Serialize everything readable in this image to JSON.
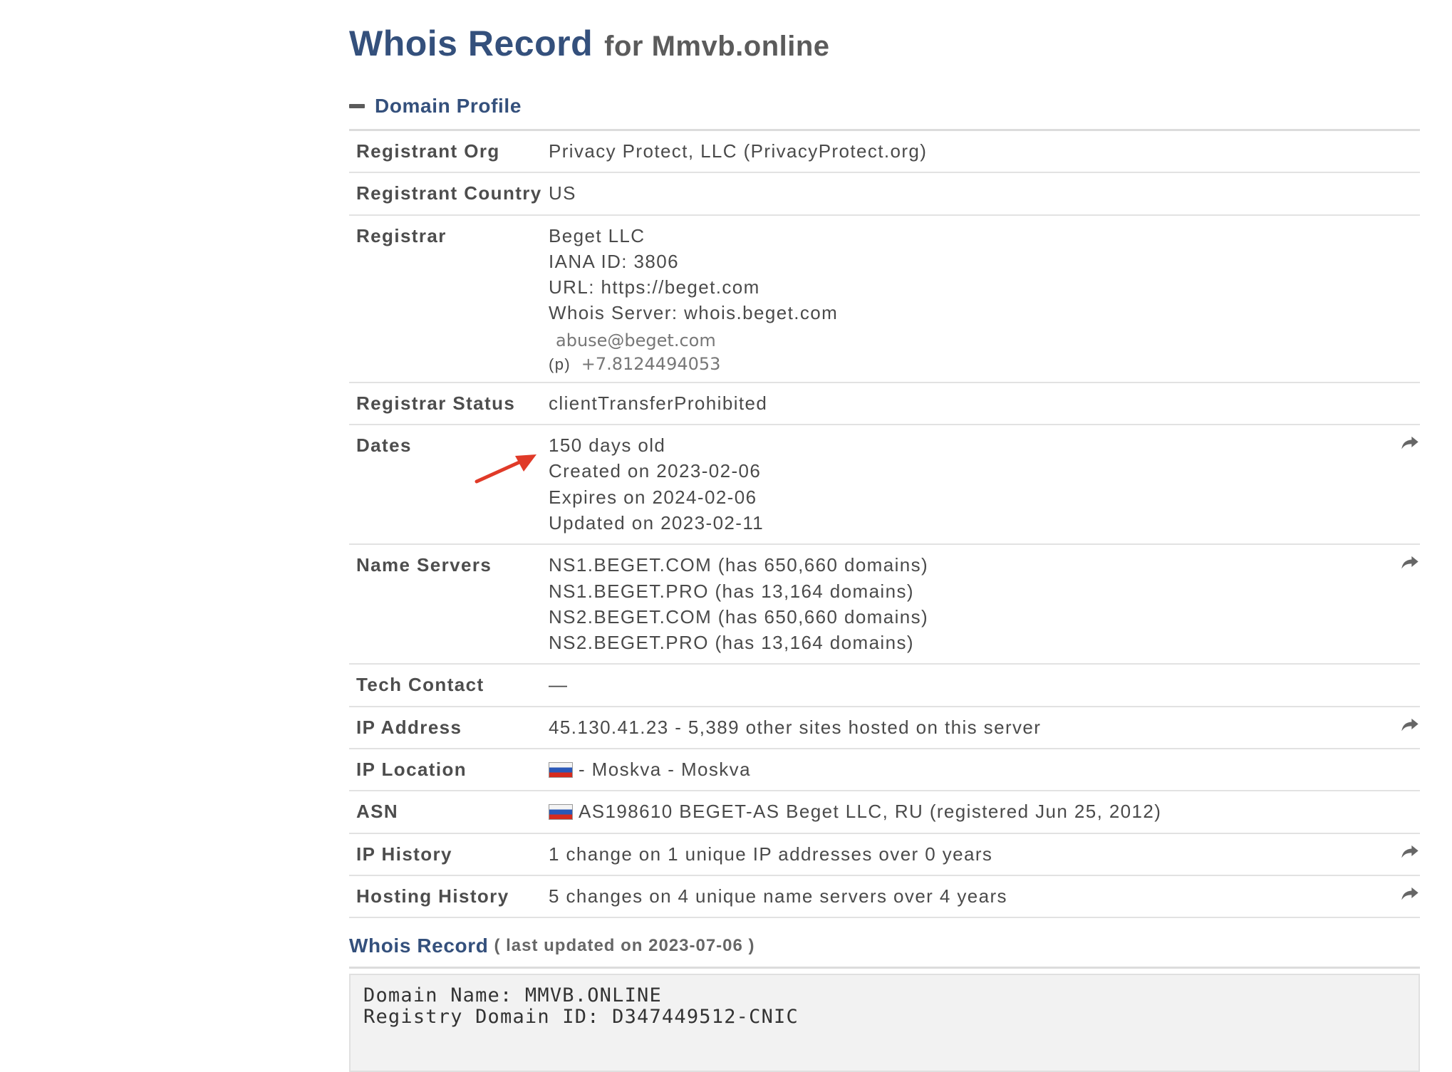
{
  "header": {
    "title": "Whois Record",
    "subtitle": "for Mmvb.online"
  },
  "domain_profile": {
    "section_label": "Domain Profile",
    "rows": {
      "registrant_org": {
        "label": "Registrant Org",
        "value": "Privacy Protect, LLC (PrivacyProtect.org)"
      },
      "registrant_country": {
        "label": "Registrant Country",
        "value": "US"
      },
      "registrar": {
        "label": "Registrar",
        "lines": [
          "Beget LLC",
          "IANA ID: 3806",
          "URL: https://beget.com",
          "Whois Server: whois.beget.com"
        ],
        "email": "abuse@beget.com",
        "phone_prefix": "(p)",
        "phone": "+7.8124494053"
      },
      "registrar_status": {
        "label": "Registrar Status",
        "value": "clientTransferProhibited"
      },
      "dates": {
        "label": "Dates",
        "lines": [
          "150 days old",
          "Created on 2023-02-06",
          "Expires on 2024-02-06",
          "Updated on 2023-02-11"
        ]
      },
      "name_servers": {
        "label": "Name Servers",
        "lines": [
          "NS1.BEGET.COM (has 650,660 domains)",
          "NS1.BEGET.PRO (has 13,164 domains)",
          "NS2.BEGET.COM (has 650,660 domains)",
          "NS2.BEGET.PRO (has 13,164 domains)"
        ]
      },
      "tech_contact": {
        "label": "Tech Contact",
        "value": "—"
      },
      "ip_address": {
        "label": "IP Address",
        "value": "45.130.41.23 - 5,389 other sites hosted on this server"
      },
      "ip_location": {
        "label": "IP Location",
        "value": "- Moskva - Moskva",
        "flag": "russia-flag-icon"
      },
      "asn": {
        "label": "ASN",
        "value": "AS198610 BEGET-AS Beget LLC, RU (registered Jun 25, 2012)",
        "flag": "russia-flag-icon"
      },
      "ip_history": {
        "label": "IP History",
        "value": "1 change on 1 unique IP addresses over 0 years"
      },
      "hosting_history": {
        "label": "Hosting History",
        "value": "5 changes on 4 unique name servers over 4 years"
      }
    }
  },
  "whois_record": {
    "title": "Whois Record",
    "note": "( last updated on 2023-07-06 )",
    "raw_lines": [
      "Domain Name: MMVB.ONLINE",
      "Registry Domain ID: D347449512-CNIC"
    ]
  },
  "icons": {
    "share": "share-arrow-icon",
    "collapse": "minus-icon",
    "annotation": "red-arrow-annotation"
  },
  "colors": {
    "link_blue": "#34507c",
    "annotation_red": "#e03a28",
    "flag_white": "#f4f4f4",
    "flag_blue": "#2a58b8",
    "flag_red": "#d52b1e"
  }
}
